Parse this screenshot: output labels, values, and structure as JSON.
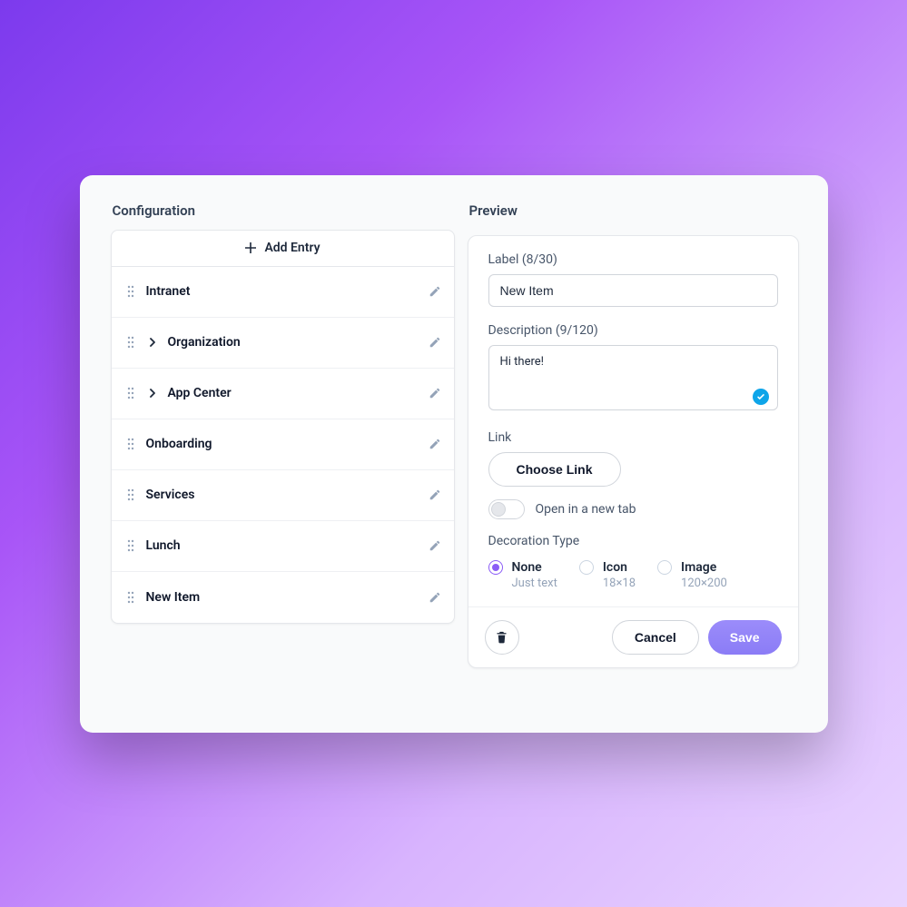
{
  "config": {
    "title": "Configuration",
    "add_label": "Add Entry",
    "items": [
      {
        "label": "Intranet",
        "expandable": false
      },
      {
        "label": "Organization",
        "expandable": true
      },
      {
        "label": "App Center",
        "expandable": true
      },
      {
        "label": "Onboarding",
        "expandable": false
      },
      {
        "label": "Services",
        "expandable": false
      },
      {
        "label": "Lunch",
        "expandable": false
      },
      {
        "label": "New Item",
        "expandable": false
      }
    ]
  },
  "preview": {
    "title": "Preview",
    "label_field": {
      "label": "Label (8/30)",
      "value": "New Item"
    },
    "description_field": {
      "label": "Description (9/120)",
      "value": "Hi there!"
    },
    "link": {
      "label": "Link",
      "button": "Choose Link",
      "new_tab_label": "Open in a new tab"
    },
    "decoration": {
      "label": "Decoration Type",
      "options": [
        {
          "label": "None",
          "sub": "Just text",
          "selected": true
        },
        {
          "label": "Icon",
          "sub": "18×18",
          "selected": false
        },
        {
          "label": "Image",
          "sub": "120×200",
          "selected": false
        }
      ]
    },
    "footer": {
      "cancel": "Cancel",
      "save": "Save"
    }
  }
}
